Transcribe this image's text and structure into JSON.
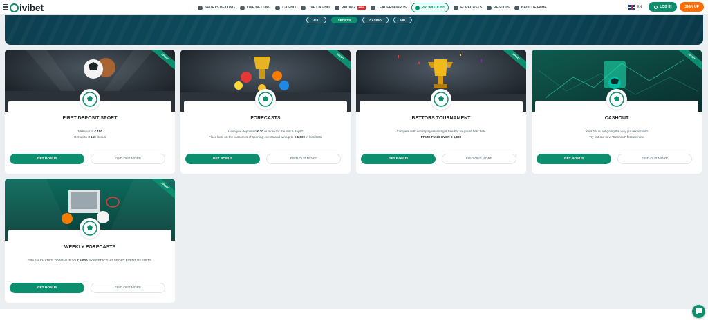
{
  "brand": {
    "name": "ivibet",
    "accent": "#0d8f6f",
    "signup_color": "#ff6d00"
  },
  "nav": [
    {
      "label": "Sports Betting",
      "icon": "soccer-ball-icon"
    },
    {
      "label": "Live Betting",
      "icon": "live-icon"
    },
    {
      "label": "Casino",
      "icon": "casino-chip-icon"
    },
    {
      "label": "Live Casino",
      "icon": "live-casino-icon"
    },
    {
      "label": "Racing",
      "icon": "horse-icon",
      "badge": "NEW"
    },
    {
      "label": "Leaderboards",
      "icon": "trophy-icon"
    },
    {
      "label": "Promotions",
      "icon": "gift-icon",
      "active": true
    },
    {
      "label": "Forecasts",
      "icon": "forecast-icon"
    },
    {
      "label": "Results",
      "icon": "results-icon"
    },
    {
      "label": "Hall of Fame",
      "icon": "crown-icon"
    }
  ],
  "header": {
    "language": "EN",
    "login_label": "LOG IN",
    "signup_label": "SIGN UP"
  },
  "filters": [
    {
      "label": "ALL",
      "active": false
    },
    {
      "label": "SPORTS",
      "active": true
    },
    {
      "label": "CASINO",
      "active": false
    },
    {
      "label": "VIP",
      "active": false
    }
  ],
  "promotions": [
    {
      "ribbon": "SPORT",
      "title": "FIRST DEPOSIT SPORT",
      "line1_pre": "100% up to ",
      "line1_bold": "€ 150",
      "line1_post": "",
      "line2_pre": "Get up to ",
      "line2_bold": "€ 150",
      "line2_post": " Bonus",
      "get_label": "GET BONUS",
      "find_label": "FIND OUT MORE"
    },
    {
      "ribbon": "SPORT",
      "title": "FORECASTS",
      "line1_pre": "Have you deposited ",
      "line1_bold": "€ 20",
      "line1_post": " or more for the last 5 days?",
      "line2_pre": "Place bets on the outcomes of sporting events and win up to ",
      "line2_bold": "€ 1,000",
      "line2_post": " in free bets.",
      "get_label": "GET BONUS",
      "find_label": "FIND OUT MORE"
    },
    {
      "ribbon": "SPORT",
      "title": "BETTORS TOURNAMENT",
      "line1_pre": "Compete with ivibet players and get free bet for yours best bets",
      "line1_bold": "",
      "line1_post": "",
      "line2_pre": "",
      "line2_bold": "PRIZE FUND OVER € 6,000",
      "line2_post": "",
      "get_label": "GET BONUS",
      "find_label": "FIND OUT MORE"
    },
    {
      "ribbon": "SPORT",
      "title": "CASHOUT",
      "line1_pre": "Your bet is not going the way you expected?",
      "line1_bold": "",
      "line1_post": "",
      "line2_pre": "Try out our new \"Cashout\" feature now.",
      "line2_bold": "",
      "line2_post": "",
      "get_label": "GET BONUS",
      "find_label": "FIND OUT MORE"
    },
    {
      "ribbon": "SPORT",
      "title": "WEEKLY FORECASTS",
      "line1_pre": "GRAB A CHANCE TO WIN UP TO ",
      "line1_bold": "€ 5,000",
      "line1_post": " BY PREDICTING SPORT EVENT RESULTS.",
      "line2_pre": "",
      "line2_bold": "",
      "line2_post": "",
      "get_label": "GET BONUS",
      "find_label": "FIND OUT MORE"
    }
  ]
}
